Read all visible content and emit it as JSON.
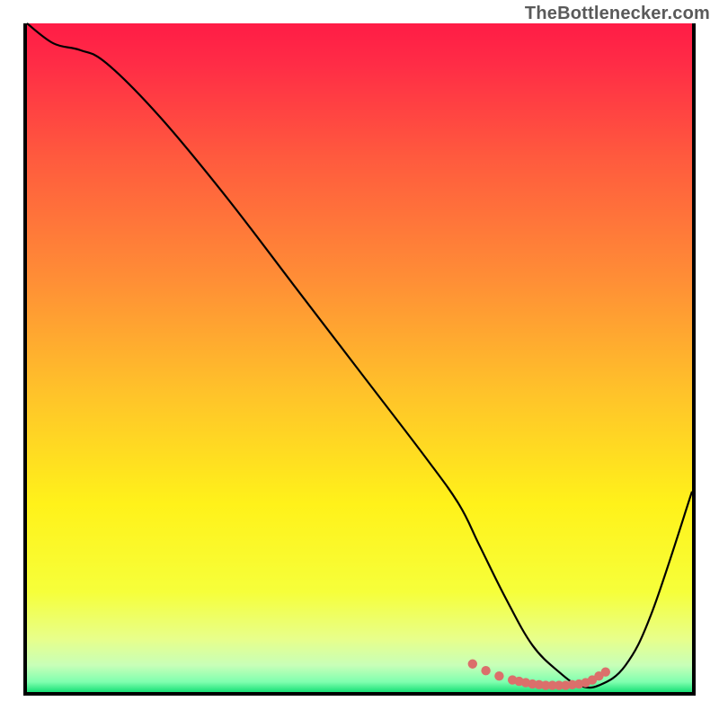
{
  "watermark": "TheBottlenecker.com",
  "chart_data": {
    "type": "line",
    "title": "",
    "xlabel": "",
    "ylabel": "",
    "xlim": [
      0,
      100
    ],
    "ylim": [
      0,
      100
    ],
    "legend": false,
    "grid": false,
    "series": [
      {
        "name": "bottleneck-curve",
        "color": "#000000",
        "x": [
          0,
          4,
          8,
          12,
          20,
          30,
          40,
          50,
          60,
          65,
          68,
          72,
          76,
          80,
          83,
          86,
          90,
          94,
          100
        ],
        "values": [
          100,
          97,
          96,
          94,
          86,
          74,
          61,
          48,
          35,
          28,
          22,
          14,
          7,
          3,
          1,
          1,
          4,
          12,
          30
        ]
      },
      {
        "name": "optimal-range-markers",
        "color": "#db6f6b",
        "style": "points",
        "x": [
          67,
          69,
          71,
          73,
          74,
          75,
          76,
          77,
          78,
          79,
          80,
          81,
          82,
          83,
          84,
          85,
          86,
          87
        ],
        "values": [
          4.2,
          3.2,
          2.4,
          1.8,
          1.6,
          1.4,
          1.2,
          1.1,
          1.0,
          1.0,
          1.0,
          1.0,
          1.1,
          1.2,
          1.4,
          1.8,
          2.4,
          3.0
        ]
      }
    ],
    "background_gradient": {
      "stops": [
        {
          "offset": 0.0,
          "color": "#ff1c46"
        },
        {
          "offset": 0.06,
          "color": "#ff2c46"
        },
        {
          "offset": 0.2,
          "color": "#ff5a3e"
        },
        {
          "offset": 0.38,
          "color": "#ff8d36"
        },
        {
          "offset": 0.55,
          "color": "#ffc22a"
        },
        {
          "offset": 0.72,
          "color": "#fff21a"
        },
        {
          "offset": 0.85,
          "color": "#f6ff3a"
        },
        {
          "offset": 0.92,
          "color": "#e8ff8a"
        },
        {
          "offset": 0.96,
          "color": "#c8ffb8"
        },
        {
          "offset": 0.985,
          "color": "#7fffaf"
        },
        {
          "offset": 1.0,
          "color": "#18e076"
        }
      ]
    }
  }
}
